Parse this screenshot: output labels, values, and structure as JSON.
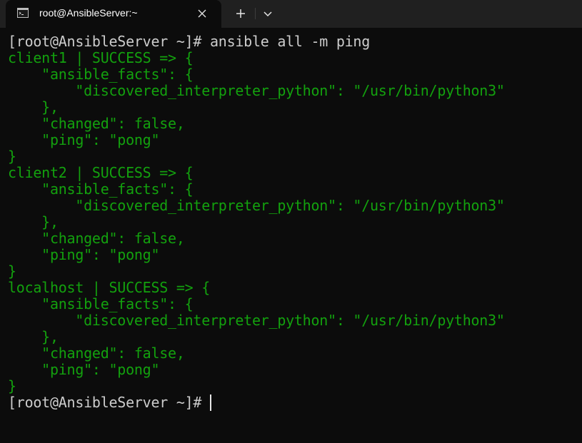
{
  "window": {
    "tab_title": "root@AnsibleServer:~",
    "tab_icon": "terminal-icon",
    "close_icon": "close-icon",
    "new_tab_icon": "plus-icon",
    "dropdown_icon": "chevron-down-icon"
  },
  "colors": {
    "background": "#0c0c0c",
    "tabbar": "#202020",
    "prompt_text": "#cccccc",
    "output_text": "#13a10e"
  },
  "terminal": {
    "prompt_command": "[root@AnsibleServer ~]# ansible all -m ping",
    "lines": [
      "client1 | SUCCESS => {",
      "    \"ansible_facts\": {",
      "        \"discovered_interpreter_python\": \"/usr/bin/python3\"",
      "    },",
      "    \"changed\": false,",
      "    \"ping\": \"pong\"",
      "}",
      "client2 | SUCCESS => {",
      "    \"ansible_facts\": {",
      "        \"discovered_interpreter_python\": \"/usr/bin/python3\"",
      "    },",
      "    \"changed\": false,",
      "    \"ping\": \"pong\"",
      "}",
      "localhost | SUCCESS => {",
      "    \"ansible_facts\": {",
      "        \"discovered_interpreter_python\": \"/usr/bin/python3\"",
      "    },",
      "    \"changed\": false,",
      "    \"ping\": \"pong\"",
      "}"
    ],
    "final_prompt": "[root@AnsibleServer ~]#"
  }
}
